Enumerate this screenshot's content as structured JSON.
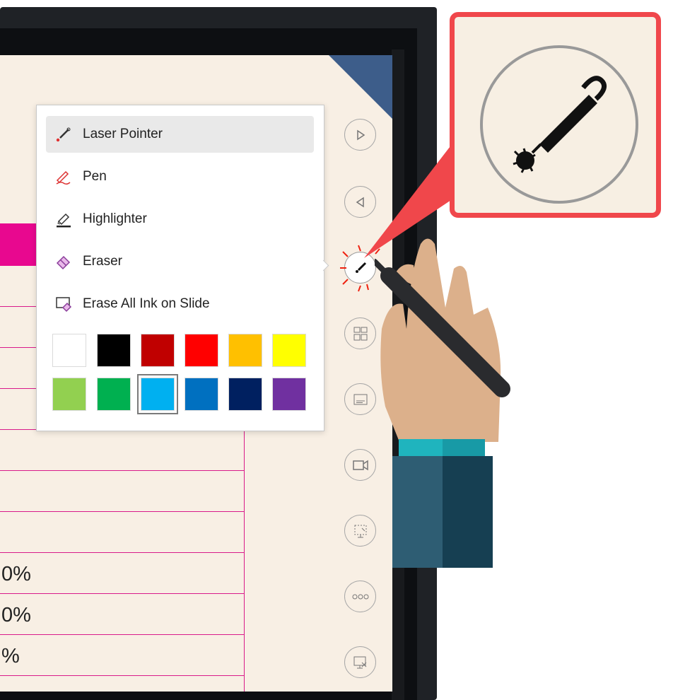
{
  "menu": {
    "items": [
      {
        "label": "Laser Pointer",
        "icon": "laser-pointer-icon"
      },
      {
        "label": "Pen",
        "icon": "pen-icon"
      },
      {
        "label": "Highlighter",
        "icon": "highlighter-icon"
      },
      {
        "label": "Eraser",
        "icon": "eraser-icon"
      },
      {
        "label": "Erase All Ink on Slide",
        "icon": "erase-all-icon"
      }
    ],
    "selected_item": "Laser Pointer",
    "colors": [
      "#ffffff",
      "#000000",
      "#c00000",
      "#ff0000",
      "#ffc000",
      "#ffff00",
      "#92d050",
      "#00b050",
      "#00b0f0",
      "#0070c0",
      "#002060",
      "#7030a0"
    ],
    "selected_color": "#00b0f0"
  },
  "slide": {
    "percents": [
      "0%",
      "0%",
      "%"
    ]
  },
  "side_toolbar": [
    "next-slide-icon",
    "previous-slide-icon",
    "pen-tools-icon",
    "see-all-slides-icon",
    "subtitles-icon",
    "camera-icon",
    "zoom-icon",
    "more-options-icon",
    "end-show-icon"
  ],
  "callout": {
    "icon": "laser-pointer-icon",
    "border_color": "#f0474b"
  }
}
